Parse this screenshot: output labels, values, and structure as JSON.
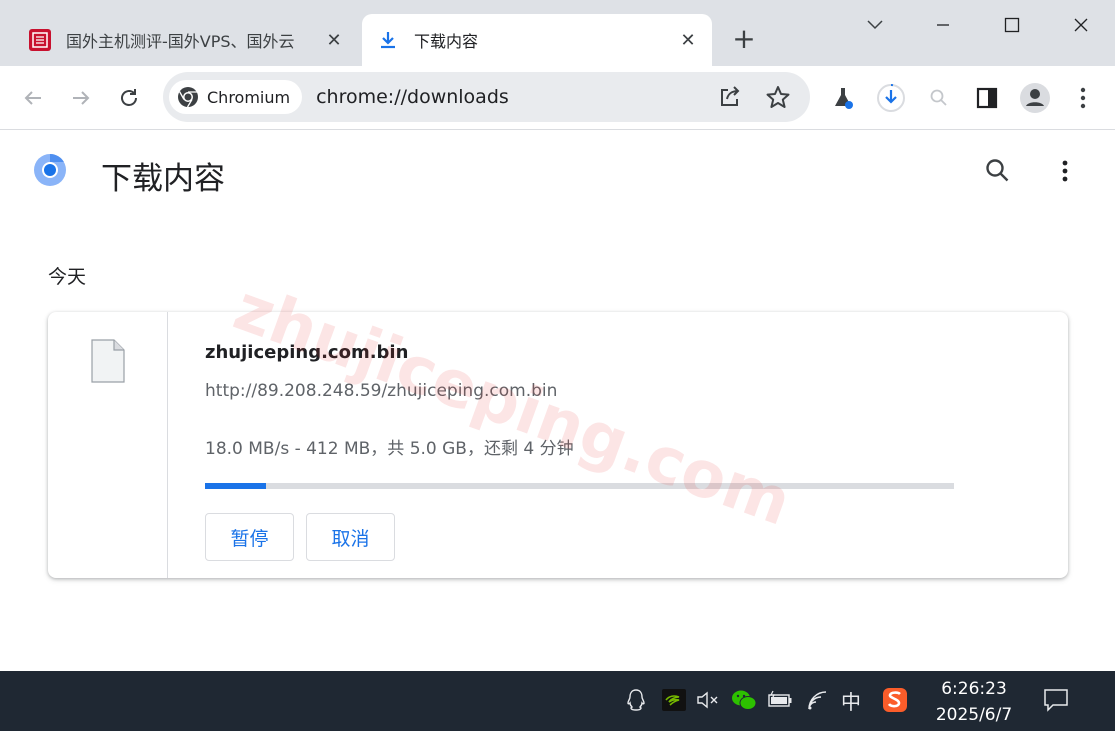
{
  "tabs": [
    {
      "title": "国外主机测评-国外VPS、国外云",
      "icon": "site-logo-icon"
    },
    {
      "title": "下载内容",
      "icon": "download-icon"
    }
  ],
  "toolbar": {
    "chip_label": "Chromium",
    "url": "chrome://downloads"
  },
  "page": {
    "title": "下载内容",
    "section_date": "今天"
  },
  "download": {
    "file_name": "zhujiceping.com.bin",
    "url": "http://89.208.248.59/zhujiceping.com.bin",
    "status": "18.0 MB/s - 412 MB，共 5.0 GB，还剩 4 分钟",
    "progress_percent": 8.2,
    "pause_label": "暂停",
    "cancel_label": "取消"
  },
  "watermark": "zhujiceping.com",
  "taskbar": {
    "ime": "中",
    "time": "6:26:23",
    "date": "2025/6/7"
  },
  "colors": {
    "accent": "#1a73e8",
    "tabstrip": "#dee1e6",
    "taskbar": "#1f2833"
  }
}
